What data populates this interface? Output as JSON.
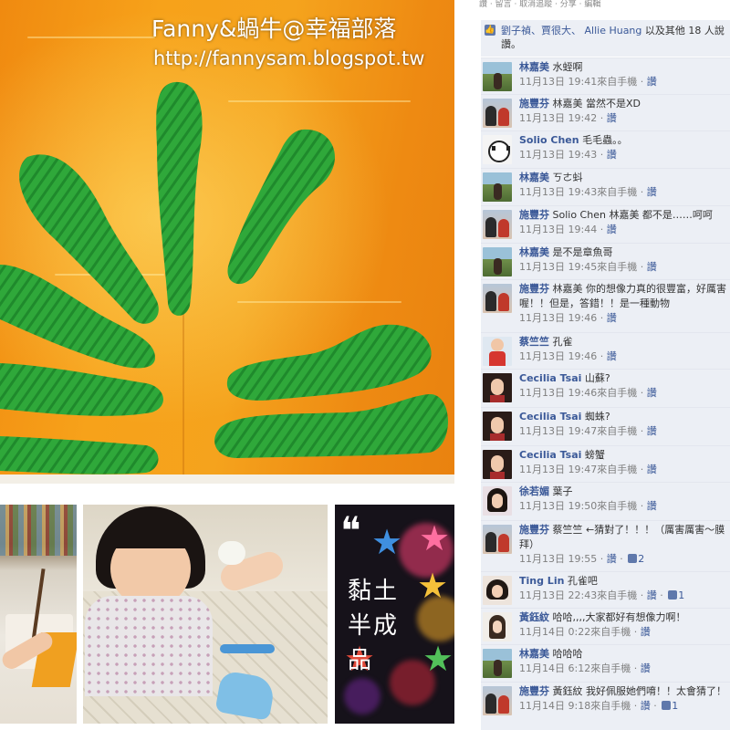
{
  "watermark": {
    "line1": "Fanny&蝸牛@幸福部落",
    "line2": "http://fannysam.blogspot.tw"
  },
  "thumbnails": {
    "third_quote": "❝",
    "third_caption": "黏土半成品"
  },
  "facebook": {
    "top_actions": "讚 · 留言 · 取消追蹤 · 分享 · 編輯",
    "likes": {
      "names": "劉子禎、賈很大、 Allie Huang",
      "suffix": "以及其他 18 人說讚。"
    },
    "comments": [
      {
        "name": "林嘉美",
        "text": "水蛭啊",
        "time": "11月13日 19:41來自手機",
        "action": "讚",
        "likes": "",
        "avatar": "park"
      },
      {
        "name": "施豐芬",
        "text": "林嘉美 當然不是XD",
        "time": "11月13日 19:42",
        "action": "讚",
        "likes": "",
        "avatar": "couple"
      },
      {
        "name": "Solio Chen",
        "text": "毛毛蟲。。",
        "time": "11月13日 19:43",
        "action": "讚",
        "likes": "",
        "avatar": "panda"
      },
      {
        "name": "林嘉美",
        "text": "ㄎㄜ蚪",
        "time": "11月13日 19:43來自手機",
        "action": "讚",
        "likes": "",
        "avatar": "park"
      },
      {
        "name": "施豐芬",
        "text": "Solio Chen 林嘉美 都不是……呵呵",
        "time": "11月13日 19:44",
        "action": "讚",
        "likes": "",
        "avatar": "couple"
      },
      {
        "name": "林嘉美",
        "text": "是不是章魚哥",
        "time": "11月13日 19:45來自手機",
        "action": "讚",
        "likes": "",
        "avatar": "park"
      },
      {
        "name": "施豐芬",
        "text": "林嘉美 你的想像力真的很豐富，好厲害喔！！但是，答錯！！是一種動物",
        "time": "11月13日 19:46",
        "action": "讚",
        "likes": "",
        "avatar": "couple"
      },
      {
        "name": "蔡竺竺",
        "text": "孔雀",
        "time": "11月13日 19:46",
        "action": "讚",
        "likes": "",
        "avatar": "kid"
      },
      {
        "name": "Cecilia Tsai",
        "text": "山蘇?",
        "time": "11月13日 19:46來自手機",
        "action": "讚",
        "likes": "",
        "avatar": "woman"
      },
      {
        "name": "Cecilia Tsai",
        "text": "蜘蛛?",
        "time": "11月13日 19:47來自手機",
        "action": "讚",
        "likes": "",
        "avatar": "woman"
      },
      {
        "name": "Cecilia Tsai",
        "text": "螃蟹",
        "time": "11月13日 19:47來自手機",
        "action": "讚",
        "likes": "",
        "avatar": "woman"
      },
      {
        "name": "徐若媚",
        "text": "葉子",
        "time": "11月13日 19:50來自手機",
        "action": "讚",
        "likes": "",
        "avatar": "girl"
      },
      {
        "name": "施豐芬",
        "text": "蔡竺竺 ←猜對了！！！（厲害厲害～膜拜）",
        "time": "11月13日 19:55",
        "action": "讚",
        "likes": "2",
        "avatar": "couple"
      },
      {
        "name": "Ting Lin",
        "text": "孔雀吧",
        "time": "11月13日 22:43來自手機",
        "action": "讚",
        "likes": "1",
        "avatar": "ting"
      },
      {
        "name": "黃鈺紋",
        "text": "哈哈,,,,大家都好有想像力啊！",
        "time": "11月14日 0:22來自手機",
        "action": "讚",
        "likes": "",
        "avatar": "huang"
      },
      {
        "name": "林嘉美",
        "text": "哈哈哈",
        "time": "11月14日 6:12來自手機",
        "action": "讚",
        "likes": "",
        "avatar": "park"
      },
      {
        "name": "施豐芬",
        "text": "黃鈺紋 我好佩服她們唷！！太會猜了！",
        "time": "11月14日 9:18來自手機",
        "action": "讚",
        "likes": "1",
        "avatar": "couple"
      }
    ]
  }
}
